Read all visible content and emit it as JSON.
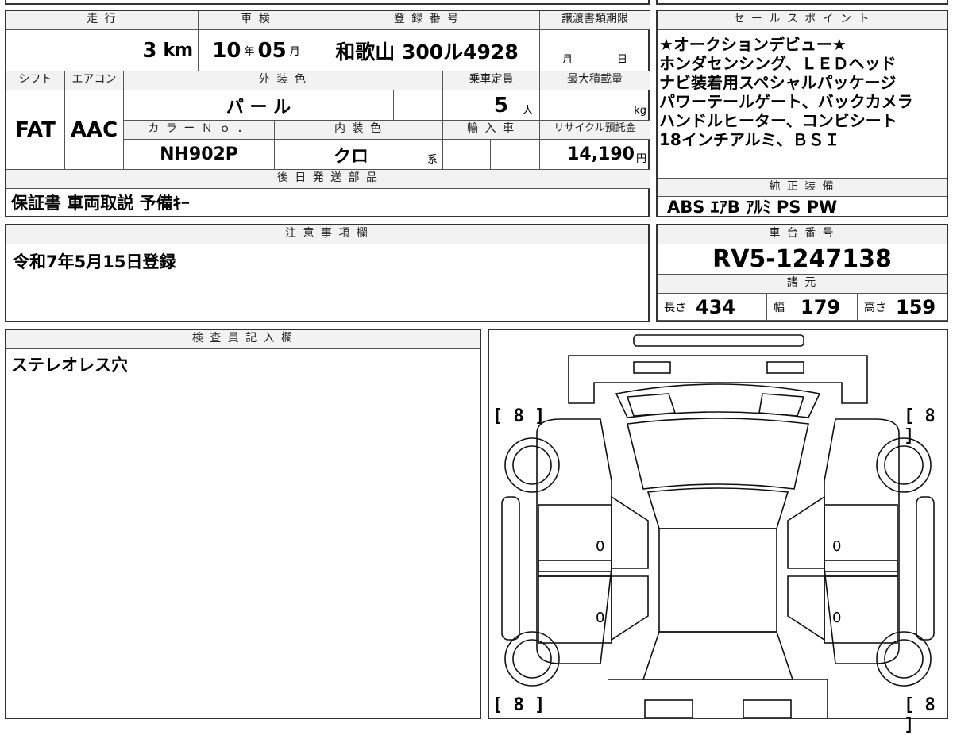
{
  "mileage": {
    "header": "走 行",
    "value": "3",
    "unit": "km"
  },
  "inspection": {
    "header": "車 検",
    "year": "10",
    "year_unit": "年",
    "month": "05",
    "month_unit": "月"
  },
  "registration": {
    "header": "登 録 番 号",
    "value": "和歌山 300ル4928"
  },
  "transfer_deadline": {
    "header": "譲渡書類期限",
    "month_unit": "月",
    "day_unit": "日"
  },
  "sales_points": {
    "header": "セ ー ル ス ポ イ ン ト",
    "lines": [
      "★オークションデビュー★",
      "ホンダセンシング、ＬＥＤヘッド",
      "ナビ装着用スペシャルパッケージ",
      "パワーテールゲート、バックカメラ",
      "ハンドルヒーター、コンビシート",
      "18インチアルミ、ＢＳＩ"
    ]
  },
  "shift": {
    "header": "シフト",
    "value": "FAT"
  },
  "aircon": {
    "header": "エアコン",
    "value": "AAC"
  },
  "exterior_color": {
    "header": "外 装 色",
    "value": "パ ー ル"
  },
  "capacity": {
    "header": "乗車定員",
    "value": "5",
    "unit": "人"
  },
  "max_load": {
    "header": "最大積載量",
    "unit": "kg"
  },
  "color_no": {
    "header": "カ ラ ー Ｎ ｏ ．",
    "value": "NH902P"
  },
  "interior_color": {
    "header": "内 装 色",
    "value": "クロ",
    "suffix": "系"
  },
  "import": {
    "header": "輸 入 車"
  },
  "recycle": {
    "header": "リサイクル預託金",
    "value": "14,190",
    "unit": "円"
  },
  "later_parts": {
    "header": "後 日 発 送 部 品",
    "value": "保証書 車両取説 予備ｷｰ"
  },
  "equipment": {
    "header": "純 正 装 備",
    "value": "ABS ｴｱB ｱﾙﾐ PS PW"
  },
  "notes": {
    "header": "注 意 事 項 欄",
    "value": "令和7年5月15日登録"
  },
  "chassis": {
    "header": "車 台 番 号",
    "value": "RV5-1247138"
  },
  "specs": {
    "header": "諸 元",
    "length_label": "長さ",
    "length": "434",
    "width_label": "幅",
    "width": "179",
    "height_label": "高さ",
    "height": "159"
  },
  "inspector": {
    "header": "検 査 員 記 入 欄",
    "value": "ステレオレス穴"
  },
  "diagram": {
    "tire_fl": "[ 8 ]",
    "tire_fr": "[ 8 ]",
    "tire_rl": "[ 8 ]",
    "tire_rr": "[ 8 ]",
    "door_fl": "0",
    "door_rl": "0",
    "door_fr": "0",
    "door_rr": "0"
  }
}
